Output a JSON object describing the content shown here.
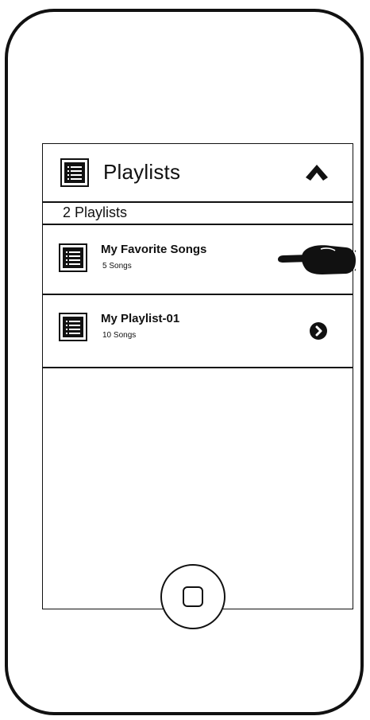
{
  "playlists_panel": {
    "title": "Playlists",
    "header_icon": "list-icon",
    "collapse_icon": "chevron-up-icon",
    "count_label": "2 Playlists"
  },
  "playlists": [
    {
      "name": "My Favorite Songs",
      "subtitle": "5 Songs",
      "icon": "list-icon",
      "indicator": "pointing-hand-icon"
    },
    {
      "name": "My Playlist-01",
      "subtitle": "10 Songs",
      "icon": "list-icon",
      "indicator": "chevron-right-circle-icon"
    }
  ],
  "device": {
    "home_button_icon": "home-square-icon"
  }
}
